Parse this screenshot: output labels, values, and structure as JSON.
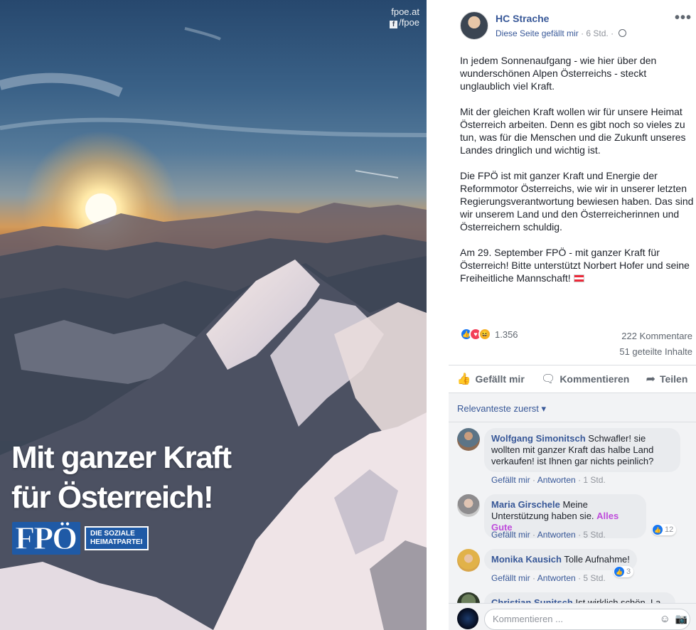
{
  "photo": {
    "watermark_site": "fpoe.at",
    "watermark_fb_glyph": "f",
    "watermark_handle": "/fpoe",
    "headline_line1": "Mit ganzer Kraft",
    "headline_line2": "für Österreich!",
    "logo_word": "FPÖ",
    "logo_tag_line1": "DIE SOZIALE",
    "logo_tag_line2": "HEIMATPARTEI"
  },
  "post": {
    "author": "HC Strache",
    "liked_page": "Diese Seite gefällt mir",
    "time": "· 6 Std. ·",
    "more_glyph": "•••",
    "paragraphs": [
      "In jedem Sonnenaufgang - wie hier über den wunderschönen Alpen Österreichs - steckt unglaublich viel Kraft.",
      "Mit der gleichen Kraft wollen wir für unsere Heimat Österreich arbeiten. Denn es gibt noch so vieles zu tun, was für die Menschen und die Zukunft unseres Landes dringlich und wichtig ist.",
      "Die FPÖ ist mit ganzer Kraft und Energie der Reformmotor Österreichs, wie wir in unserer letzten Regierungsverantwortung bewiesen haben. Das sind wir unserem Land und den Österreicherinnen und Österreichern schuldig.",
      "Am 29. September FPÖ - mit ganzer Kraft für Österreich! Bitte unterstützt Norbert Hofer und seine Freiheitliche Mannschaft!"
    ],
    "reaction_count": "1.356",
    "comments_count": "222 Kommentare",
    "shares_count": "51 geteilte Inhalte",
    "actions": {
      "like": "Gefällt mir",
      "comment": "Kommentieren",
      "share": "Teilen"
    },
    "colors": {
      "link": "#385898",
      "like_blue": "#1877f2",
      "love_red": "#f33e58",
      "haha_yellow": "#f7b125"
    }
  },
  "comments": {
    "sort_label": "Relevanteste zuerst",
    "sort_glyph": "▾",
    "like_label": "Gefällt mir",
    "reply_label": "Antworten",
    "items": [
      {
        "name": "Wolfgang Simonitsch",
        "text": "Schwafler! sie wollten mit ganzer Kraft das halbe Land verkaufen! ist Ihnen gar nichts peinlich?",
        "time": "1 Std."
      },
      {
        "name": "Maria Girschele",
        "text": "Meine Unterstützung haben sie.",
        "mention": "Alles Gute",
        "time": "5 Std.",
        "likes": "12"
      },
      {
        "name": "Monika Kausich",
        "text": "Tolle Aufnahme!",
        "time": "5 Std.",
        "likes": "3"
      },
      {
        "name": "Christian Sunitsch",
        "text": "Ist wirklich schön. La..."
      }
    ],
    "composer_placeholder": "Kommentieren ...",
    "emoji_glyph": "☺",
    "camera_glyph": "📷"
  }
}
